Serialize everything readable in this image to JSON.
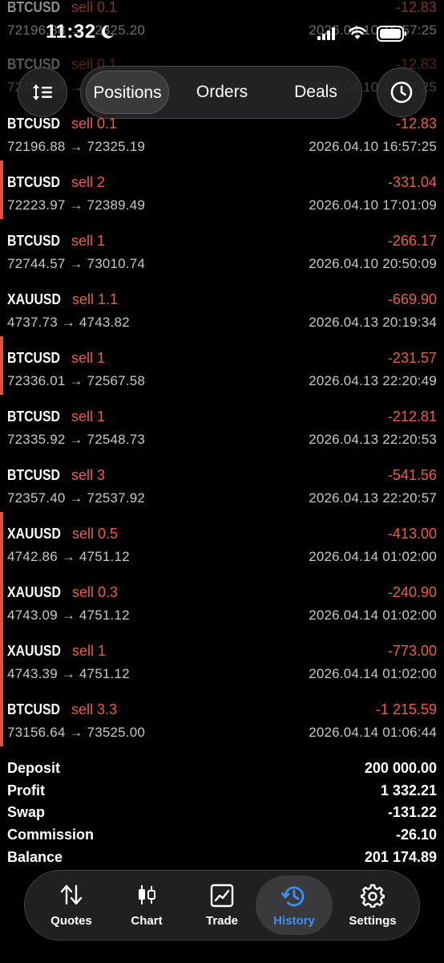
{
  "status_bar": {
    "time": "11:32"
  },
  "ghost_rows": [
    {
      "symbol": "BTCUSD",
      "side": "sell 0.1",
      "pnl": "-12.83",
      "prices": "72196.88 → 72325.20",
      "datetime": "2026.04.10 16:57:25"
    },
    {
      "symbol": "BTCUSD",
      "side": "sell 0.1",
      "pnl": "-12.83",
      "prices": "72196.88 → 72325.19",
      "datetime": "2026.04.10 16:57:25"
    }
  ],
  "top_nav": {
    "tabs": [
      {
        "label": "Positions"
      },
      {
        "label": "Orders"
      },
      {
        "label": "Deals"
      }
    ],
    "active_tab": "Positions"
  },
  "deals": [
    {
      "symbol": "BTCUSD",
      "side": "sell 0.1",
      "pnl": "-12.83",
      "prices": "72196.88 → 72325.19",
      "datetime": "2026.04.10 16:57:25",
      "marked": false
    },
    {
      "symbol": "BTCUSD",
      "side": "sell 2",
      "pnl": "-331.04",
      "prices": "72223.97 → 72389.49",
      "datetime": "2026.04.10 17:01:09",
      "marked": true
    },
    {
      "symbol": "BTCUSD",
      "side": "sell 1",
      "pnl": "-266.17",
      "prices": "72744.57 → 73010.74",
      "datetime": "2026.04.10 20:50:09",
      "marked": false
    },
    {
      "symbol": "XAUUSD",
      "side": "sell 1.1",
      "pnl": "-669.90",
      "prices": "4737.73 → 4743.82",
      "datetime": "2026.04.13 20:19:34",
      "marked": false
    },
    {
      "symbol": "BTCUSD",
      "side": "sell 1",
      "pnl": "-231.57",
      "prices": "72336.01 → 72567.58",
      "datetime": "2026.04.13 22:20:49",
      "marked": true
    },
    {
      "symbol": "BTCUSD",
      "side": "sell 1",
      "pnl": "-212.81",
      "prices": "72335.92 → 72548.73",
      "datetime": "2026.04.13 22:20:53",
      "marked": false
    },
    {
      "symbol": "BTCUSD",
      "side": "sell 3",
      "pnl": "-541.56",
      "prices": "72357.40 → 72537.92",
      "datetime": "2026.04.13 22:20:57",
      "marked": false
    },
    {
      "symbol": "XAUUSD",
      "side": "sell 0.5",
      "pnl": "-413.00",
      "prices": "4742.86 → 4751.12",
      "datetime": "2026.04.14 01:02:00",
      "marked": true
    },
    {
      "symbol": "XAUUSD",
      "side": "sell 0.3",
      "pnl": "-240.90",
      "prices": "4743.09 → 4751.12",
      "datetime": "2026.04.14 01:02:00",
      "marked": true
    },
    {
      "symbol": "XAUUSD",
      "side": "sell 1",
      "pnl": "-773.00",
      "prices": "4743.39 → 4751.12",
      "datetime": "2026.04.14 01:02:00",
      "marked": true
    },
    {
      "symbol": "BTCUSD",
      "side": "sell 3.3",
      "pnl": "-1 215.59",
      "prices": "73156.64 → 73525.00",
      "datetime": "2026.04.14 01:06:44",
      "marked": true
    }
  ],
  "summary": {
    "deposit_label": "Deposit",
    "deposit": "200 000.00",
    "profit_label": "Profit",
    "profit": "1 332.21",
    "swap_label": "Swap",
    "swap": "-131.22",
    "commission_label": "Commission",
    "commission": "-26.10",
    "balance_label": "Balance",
    "balance": "201 174.89"
  },
  "tab_bar": {
    "items": [
      {
        "label": "Quotes",
        "icon": "arrows-updown-icon"
      },
      {
        "label": "Chart",
        "icon": "candlestick-icon"
      },
      {
        "label": "Trade",
        "icon": "trend-chart-icon"
      },
      {
        "label": "History",
        "icon": "history-clock-icon"
      },
      {
        "label": "Settings",
        "icon": "gear-icon"
      }
    ],
    "active": "History"
  },
  "colors": {
    "background": "#000000",
    "loss": "#e8604b",
    "marker": "#e0533b",
    "active_tab": "#3e8ef7",
    "secondary_text": "#c8c8c8"
  }
}
